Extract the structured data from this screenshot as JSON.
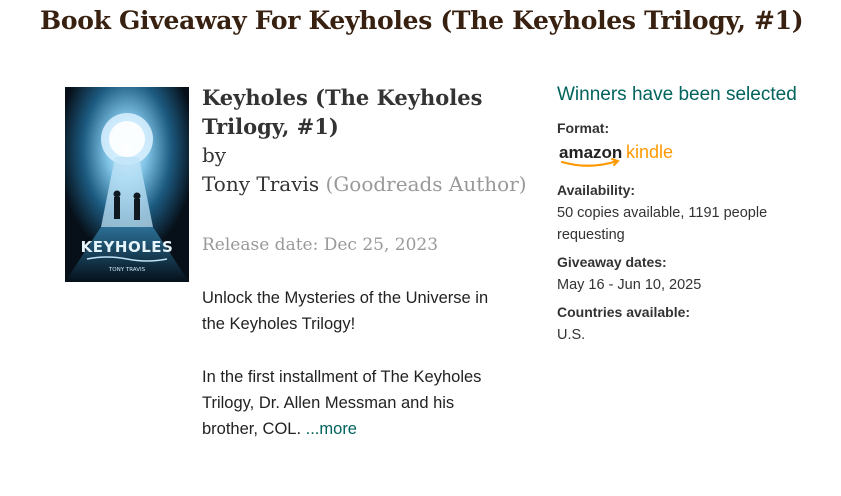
{
  "page": {
    "title": "Book Giveaway For Keyholes (The Keyholes Trilogy, #1)"
  },
  "book": {
    "cover_title": "KEYHOLES",
    "cover_author": "TONY TRAVIS",
    "title": "Keyholes (The Keyholes Trilogy, #1)",
    "by": "by",
    "author": "Tony Travis",
    "author_role": "(Goodreads Author)",
    "release_date": "Release date: Dec 25, 2023",
    "description_p1": "Unlock the Mysteries of the Universe in the Keyholes Trilogy!",
    "description_p2": "In the first installment of The Keyholes Trilogy, Dr. Allen Messman and his brother, COL. ",
    "more_link": "...more"
  },
  "giveaway": {
    "status": "Winners have been selected",
    "format_label": "Format:",
    "format_logo_word1": "amazon",
    "format_logo_word2": "kindle",
    "availability_label": "Availability:",
    "availability_value": "50 copies available, 1191 people requesting",
    "dates_label": "Giveaway dates:",
    "dates_value": "May 16 - Jun 10, 2025",
    "countries_label": "Countries available:",
    "countries_value": "U.S."
  },
  "colors": {
    "title": "#382110",
    "link": "#00635d",
    "muted": "#999999",
    "amazon_orange": "#ff9900"
  }
}
